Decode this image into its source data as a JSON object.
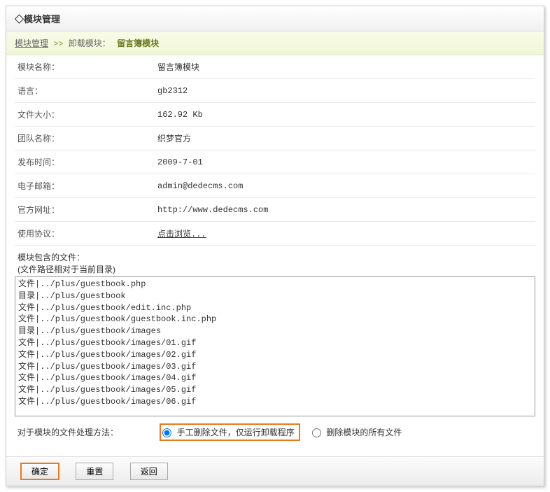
{
  "header": {
    "title": "◇模块管理"
  },
  "breadcrumb": {
    "root": "模块管理",
    "separator": ">>",
    "action": "卸载模块：",
    "module": "留言簿模块"
  },
  "info": {
    "module_name": {
      "label": "模块名称：",
      "value": "留言簿模块"
    },
    "language": {
      "label": "语言：",
      "value": "gb2312"
    },
    "file_size": {
      "label": "文件大小：",
      "value": "162.92 Kb"
    },
    "team_name": {
      "label": "团队名称：",
      "value": "织梦官方"
    },
    "publish_time": {
      "label": "发布时间：",
      "value": "2009-7-01"
    },
    "email": {
      "label": "电子邮箱：",
      "value": "admin@dedecms.com"
    },
    "official_url": {
      "label": "官方网址：",
      "value": "http://www.dedecms.com"
    },
    "license": {
      "label": "使用协议：",
      "value": "点击浏览..."
    }
  },
  "files": {
    "section_label1": "模块包含的文件：",
    "section_label2": "(文件路径相对于当前目录)",
    "list": [
      "文件|../plus/guestbook.php",
      "目录|../plus/guestbook",
      "文件|../plus/guestbook/edit.inc.php",
      "文件|../plus/guestbook/guestbook.inc.php",
      "目录|../plus/guestbook/images",
      "文件|../plus/guestbook/images/01.gif",
      "文件|../plus/guestbook/images/02.gif",
      "文件|../plus/guestbook/images/03.gif",
      "文件|../plus/guestbook/images/04.gif",
      "文件|../plus/guestbook/images/05.gif",
      "文件|../plus/guestbook/images/06.gif"
    ]
  },
  "method": {
    "label": "对于模块的文件处理方法：",
    "option_manual": "手工删除文件，仅运行卸载程序",
    "option_delete_all": "删除模块的所有文件"
  },
  "buttons": {
    "confirm": "确定",
    "reset": "重置",
    "back": "返回"
  }
}
